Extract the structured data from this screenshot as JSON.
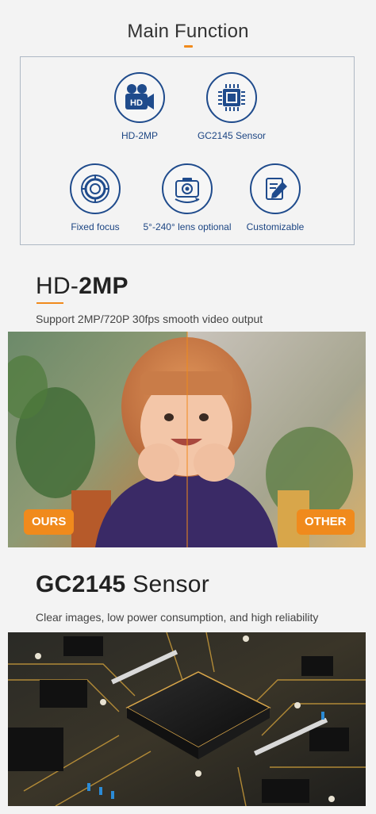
{
  "header": {
    "title": "Main Function"
  },
  "features": [
    {
      "label": "HD-2MP",
      "icon": "hd-camera-icon"
    },
    {
      "label": "GC2145 Sensor",
      "icon": "chip-icon"
    },
    {
      "label": "Fixed focus",
      "icon": "lens-ring-icon"
    },
    {
      "label": "5°-240° lens optional",
      "icon": "camera-rotate-icon"
    },
    {
      "label": "Customizable",
      "icon": "edit-pencil-icon"
    }
  ],
  "hd_section": {
    "title_prefix": "HD-",
    "title_bold": "2MP",
    "subtitle": "Support 2MP/720P 30fps smooth video output",
    "tag_left": "OURS",
    "tag_right": "OTHER"
  },
  "sensor_section": {
    "title_bold": "GC2145",
    "title_suffix": " Sensor",
    "subtitle": "Clear images, low power consumption, and high reliability"
  },
  "colors": {
    "accent": "#f08a1c",
    "icon_blue": "#1f4b8c",
    "background": "#f3f3f3"
  }
}
